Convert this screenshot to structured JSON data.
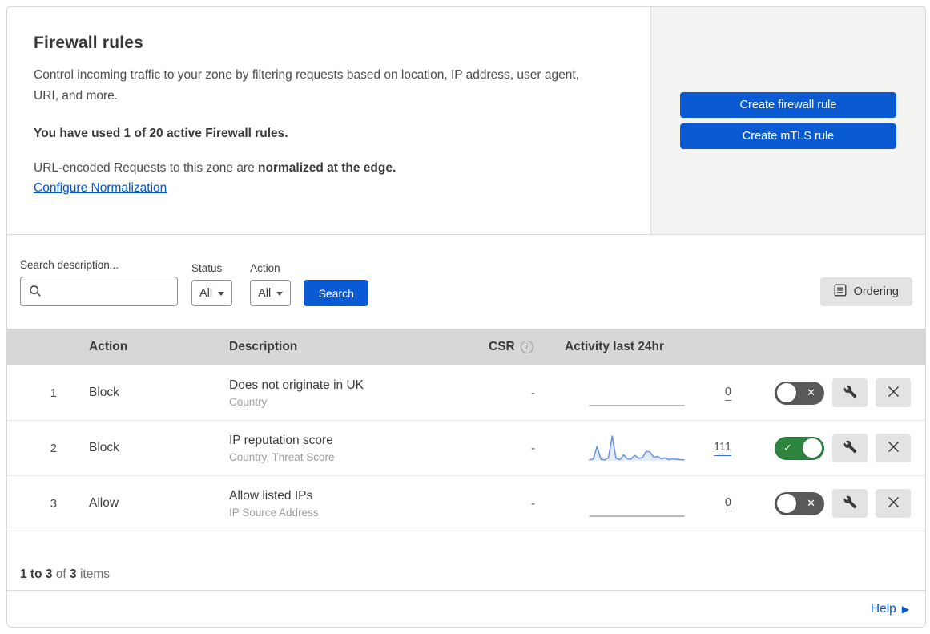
{
  "card": {
    "header": {
      "title": "Firewall rules",
      "description": "Control incoming traffic to your zone by filtering requests based on location, IP address, user agent, URI, and more.",
      "usage_note": "You have used 1 of 20 active Firewall rules.",
      "normalization_text": "URL-encoded Requests to this zone are",
      "normalization_bold": "normalized at the edge.",
      "normalization_link": "Configure Normalization",
      "create_firewall_button": "Create firewall rule",
      "create_mtls_button": "Create mTLS rule"
    },
    "filters": {
      "search_label": "Search description...",
      "search_value": "",
      "status_label": "Status",
      "status_value": "All",
      "action_label": "Action",
      "action_value": "All",
      "search_button": "Search",
      "ordering_button": "Ordering"
    },
    "table": {
      "headers": {
        "action": "Action",
        "description": "Description",
        "csr": "CSR",
        "activity": "Activity last 24hr"
      },
      "rows": [
        {
          "index": "1",
          "action": "Block",
          "title": "Does not originate in UK",
          "subtitle": "Country",
          "csr": "-",
          "count": "0",
          "enabled": false,
          "sparkline": [
            0,
            0
          ],
          "spark_color": "#a3a3a3",
          "spark_fill": ""
        },
        {
          "index": "2",
          "action": "Block",
          "title": "IP reputation score",
          "subtitle": "Country, Threat Score",
          "csr": "-",
          "count": "111",
          "enabled": true,
          "sparkline": [
            4,
            8,
            58,
            6,
            4,
            12,
            100,
            10,
            5,
            24,
            8,
            7,
            22,
            10,
            13,
            38,
            35,
            14,
            18,
            8,
            12,
            5,
            8,
            6,
            5,
            4
          ],
          "spark_color": "#6c96e3",
          "spark_fill": "rgba(108,150,227,0.18)"
        },
        {
          "index": "3",
          "action": "Allow",
          "title": "Allow listed IPs",
          "subtitle": "IP Source Address",
          "csr": "-",
          "count": "0",
          "enabled": false,
          "sparkline": [
            0,
            0
          ],
          "spark_color": "#a3a3a3",
          "spark_fill": ""
        }
      ]
    },
    "footer": {
      "range": "1 to 3",
      "of_text": "of",
      "total": "3",
      "items_text": "items",
      "help_label": "Help"
    }
  },
  "icons": {
    "check": "✓",
    "x": "✕",
    "info": "i",
    "help_arrow": "▶"
  },
  "colors": {
    "brand_blue": "#0a5bd3",
    "link_blue": "#0056d2",
    "toggle_on_green": "#2e8540",
    "toggle_off_grey": "#595959",
    "table_header_grey": "#d7d7d7",
    "side_panel_grey": "#f3f3f2",
    "control_grey": "#e3e3e3",
    "sparkline_blue": "#6c96e3"
  }
}
